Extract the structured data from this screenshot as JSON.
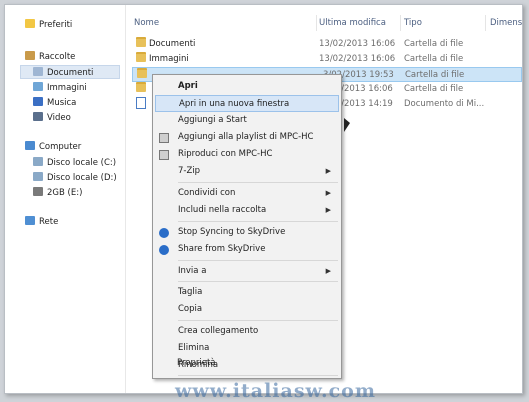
{
  "nav": {
    "favorites": "Preferiti",
    "libraries": "Raccolte",
    "documents": "Documenti",
    "pictures": "Immagini",
    "music": "Musica",
    "video": "Video",
    "computer": "Computer",
    "drive_c": "Disco locale (C:)",
    "drive_d": "Disco locale (D:)",
    "drive_e": "2GB (E:)",
    "network": "Rete"
  },
  "columns": {
    "name": "Nome",
    "modified": "Ultima modifica",
    "type": "Tipo",
    "size": "Dimensi"
  },
  "rows": [
    {
      "name": "Documenti",
      "modified": "13/02/2013 16:06",
      "type": "Cartella di file"
    },
    {
      "name": "Immagini",
      "modified": "13/02/2013 16:06",
      "type": "Cartella di file"
    },
    {
      "name": "",
      "modified": "3/02/2013 19:53",
      "type": "Cartella di file"
    },
    {
      "name": "",
      "modified": "3/02/2013 16:06",
      "type": "Cartella di file"
    },
    {
      "name": "",
      "modified": "3/02/2013 14:19",
      "type": "Documento di Mi..."
    }
  ],
  "menu": {
    "open": "Apri",
    "open_new_window": "Apri in una nuova finestra",
    "pin_start": "Aggiungi a Start",
    "add_playlist": "Aggiungi alla playlist di MPC-HC",
    "play_mpc": "Riproduci con MPC-HC",
    "zip": "7-Zip",
    "share_with": "Condividi con",
    "include_library": "Includi nella raccolta",
    "stop_sync": "Stop Syncing to SkyDrive",
    "share_skydrive": "Share from SkyDrive",
    "send_to": "Invia a",
    "cut": "Taglia",
    "copy": "Copia",
    "create_shortcut": "Crea collegamento",
    "delete": "Elimina",
    "rename": "Rinomina",
    "properties": "Proprietà"
  },
  "watermark": "www.italiasw.com",
  "colors": {
    "accent": "#cce4f7",
    "menu_bg": "#f2f2f2",
    "folder": "#e8c15a",
    "header_text": "#4d6082"
  }
}
